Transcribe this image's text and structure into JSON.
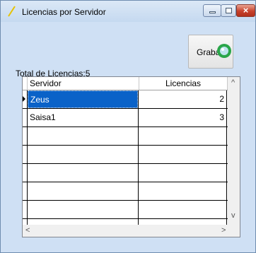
{
  "window": {
    "title": "Licencias por Servidor",
    "minimize_label": "_",
    "maximize_label": "□",
    "close_label": "x"
  },
  "summary": {
    "total_label": "Total de Licencias:5"
  },
  "toolbar": {
    "save_label": "Grabar"
  },
  "grid": {
    "columns": [
      "Servidor",
      "Licencias"
    ],
    "rows": [
      {
        "server": "Zeus",
        "licenses": "2",
        "selected": true
      },
      {
        "server": "Saisa1",
        "licenses": "3",
        "selected": false
      },
      {
        "server": "",
        "licenses": ""
      },
      {
        "server": "",
        "licenses": ""
      },
      {
        "server": "",
        "licenses": ""
      },
      {
        "server": "",
        "licenses": ""
      },
      {
        "server": "",
        "licenses": ""
      },
      {
        "server": "",
        "licenses": ""
      }
    ],
    "scroll_up": "^",
    "scroll_down": "v",
    "scroll_left": "<",
    "scroll_right": ">"
  },
  "colors": {
    "selection": "#0a62c8",
    "window_frame": "#cfe0f4"
  }
}
